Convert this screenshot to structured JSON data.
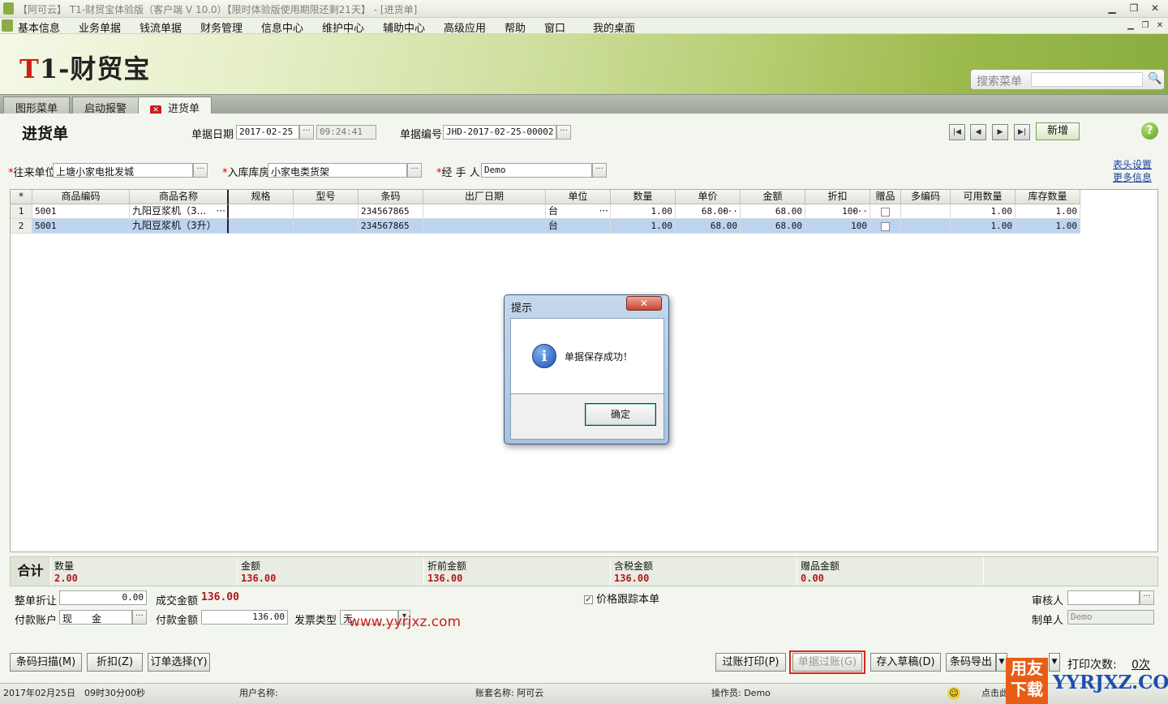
{
  "window": {
    "title": "【阿可云】 T1-财贸宝体验版（客户端 V 10.0）【限时体验版使用期限还剩21天】 - [进货单]"
  },
  "menu": [
    "基本信息",
    "业务单据",
    "钱流单据",
    "财务管理",
    "信息中心",
    "维护中心",
    "辅助中心",
    "高级应用",
    "帮助",
    "窗口",
    "我的桌面"
  ],
  "brand": {
    "logo_red": "T",
    "logo_rest": "1-财贸宝"
  },
  "search": {
    "placeholder": "搜索菜单"
  },
  "tabs": [
    "图形菜单",
    "启动报警",
    "进货单"
  ],
  "form": {
    "title": "进货单",
    "date_label": "单据日期",
    "date": "2017-02-25",
    "time": "09:24:41",
    "number_label": "单据编号",
    "number": "JHD-2017-02-25-00002",
    "new_button": "新增",
    "vendor_label": "往来单位",
    "vendor": "上塘小家电批发城",
    "warehouse_label": "入库库房",
    "warehouse": "小家电类货架",
    "handler_label": "经 手 人",
    "handler": "Demo",
    "header_settings": "表头设置",
    "more_info": "更多信息"
  },
  "grid": {
    "columns": [
      "*",
      "商品编码",
      "商品名称",
      "规格",
      "型号",
      "条码",
      "出厂日期",
      "单位",
      "数量",
      "单价",
      "金额",
      "折扣",
      "赠品",
      "多编码",
      "可用数量",
      "库存数量"
    ],
    "rows": [
      {
        "no": "1",
        "code": "5001",
        "name": "九阳豆浆机（3...",
        "spec": "",
        "model": "",
        "barcode": "234567865",
        "date": "",
        "unit": "台",
        "qty": "1.00",
        "price": "68.00",
        "amount": "68.00",
        "discount": "100",
        "avail": "1.00",
        "stock": "1.00"
      },
      {
        "no": "2",
        "code": "5001",
        "name": "九阳豆浆机（3升）",
        "spec": "",
        "model": "",
        "barcode": "234567865",
        "date": "",
        "unit": "台",
        "qty": "1.00",
        "price": "68.00",
        "amount": "68.00",
        "discount": "100",
        "avail": "1.00",
        "stock": "1.00"
      }
    ]
  },
  "totals": {
    "label": "合计",
    "items": [
      {
        "label": "数量",
        "value": "2.00"
      },
      {
        "label": "金额",
        "value": "136.00"
      },
      {
        "label": "折前金额",
        "value": "136.00"
      },
      {
        "label": "含税金额",
        "value": "136.00"
      },
      {
        "label": "赠品金额",
        "value": "0.00"
      }
    ]
  },
  "footer_form": {
    "discount_label": "整单折让",
    "discount": "0.00",
    "deal_label": "成交金额",
    "deal": "136.00",
    "price_track": "价格跟踪本单",
    "reviewer_label": "审核人",
    "account_label": "付款账户",
    "account": "现　　金",
    "pay_label": "付款金额",
    "pay": "136.00",
    "invoice_label": "发票类型",
    "invoice": "无",
    "maker_label": "制单人",
    "maker": "Demo"
  },
  "watermark_url": "www.yyrjxz.com",
  "buttons": {
    "scan": "条码扫描(M)",
    "discount": "折扣(Z)",
    "order": "订单选择(Y)",
    "post_print": "过账打印(P)",
    "post": "单据过账(G)",
    "draft": "存入草稿(D)",
    "export": "条码导出",
    "print_count_label": "打印次数:",
    "print_count": "0次"
  },
  "status": {
    "datetime": "2017年02月25日　09时30分00秒",
    "user": "用户名称:",
    "account_set": "账套名称: 阿可云",
    "operator": "操作员: Demo",
    "hint": "点击此"
  },
  "dialog": {
    "title": "提示",
    "message": "单据保存成功！",
    "ok": "确定"
  },
  "badge": {
    "line1": "用友",
    "line2": "下载",
    "site": "YYRJXZ.COM"
  }
}
